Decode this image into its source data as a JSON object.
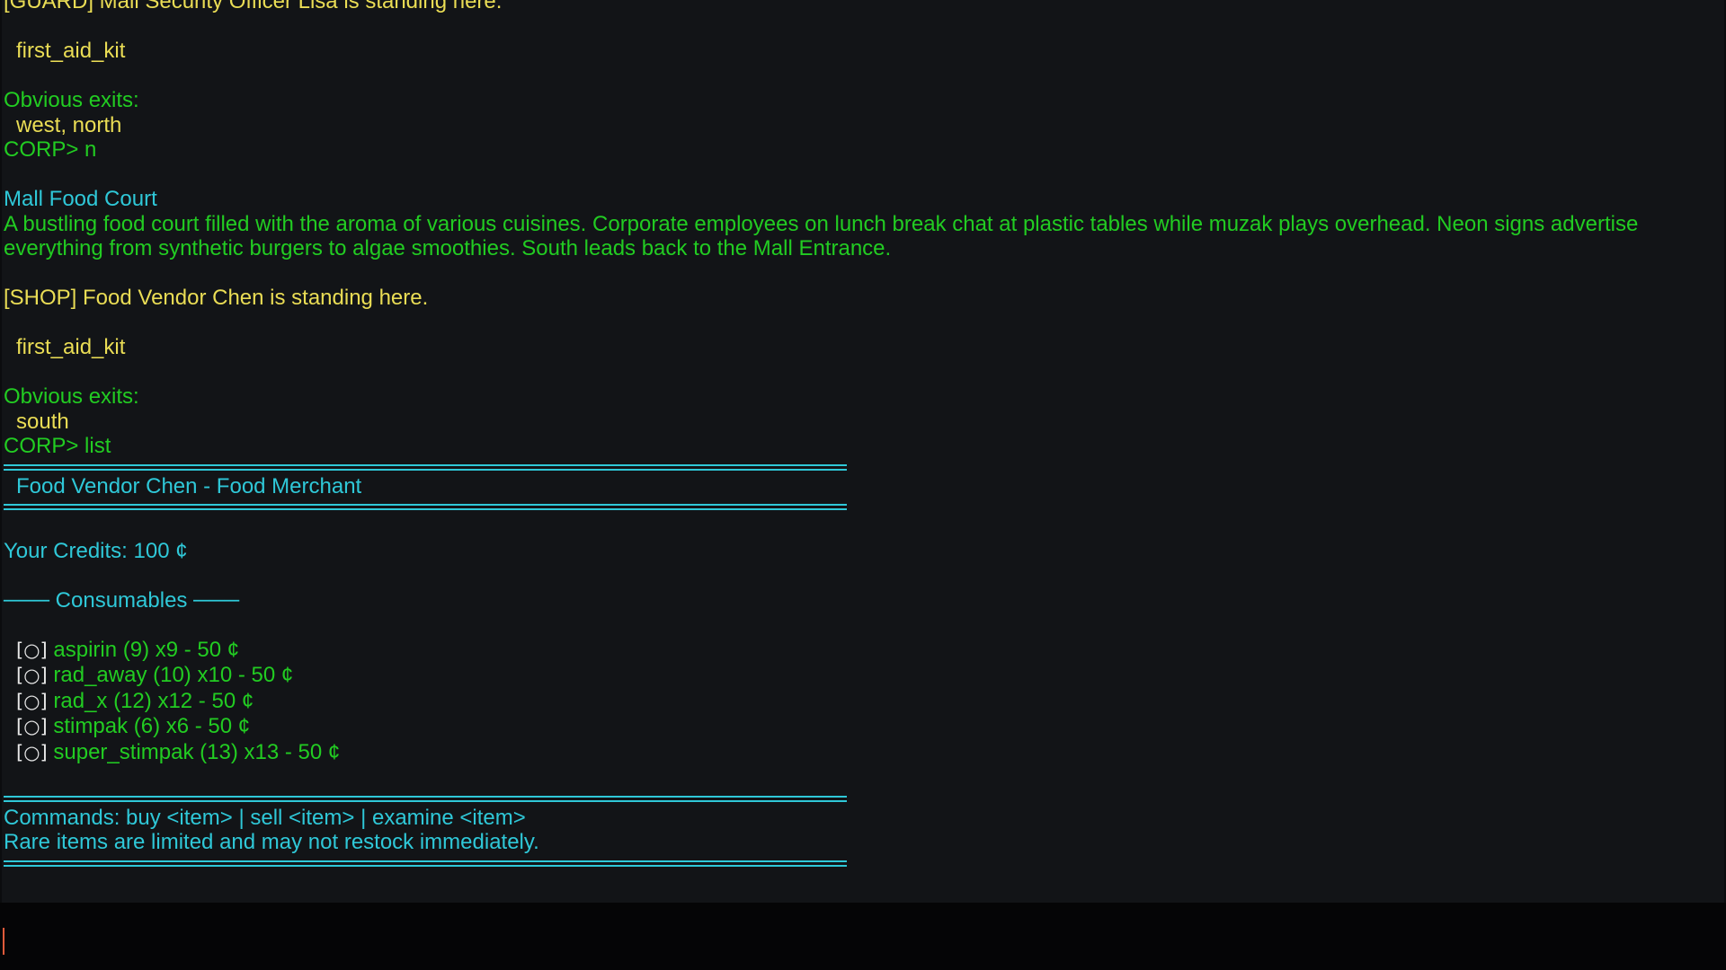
{
  "log": {
    "prev_guard_line": "[GUARD] Mall Security Officer Lisa is standing here.",
    "prev_item": "first_aid_kit",
    "prev_exits_label": "Obvious exits:",
    "prev_exits": "west, north",
    "prev_command": "CORP> n",
    "room_name": "Mall Food Court",
    "room_desc": "A bustling food court filled with the aroma of various cuisines. Corporate employees on lunch break chat at plastic tables while muzak plays overhead. Neon signs advertise everything from synthetic burgers to algae smoothies. South leads back to the Mall Entrance.",
    "npc_line": "[SHOP] Food Vendor Chen is standing here.",
    "room_item": "first_aid_kit",
    "exits_label": "Obvious exits:",
    "exits": "south",
    "command": "CORP> list"
  },
  "shop": {
    "title": "Food Vendor Chen - Food Merchant",
    "credits": "Your Credits: 100 ¢",
    "category": "─── Consumables ───",
    "item_marker": "[○]",
    "items": [
      {
        "text": "aspirin (9) x9 - 50 ¢"
      },
      {
        "text": "rad_away (10) x10 - 50 ¢"
      },
      {
        "text": "rad_x (12) x12 - 50 ¢"
      },
      {
        "text": "stimpak (6) x6 - 50 ¢"
      },
      {
        "text": "super_stimpak (13) x13 - 50 ¢"
      }
    ],
    "commands": "Commands: buy <item> | sell <item> | examine <item>",
    "note": "Rare items are limited and may not restock immediately."
  },
  "input": {
    "value": ""
  },
  "colors": {
    "system_yellow": "#eadd55",
    "room_green": "#22cc22",
    "shop_cyan": "#2fc8d8",
    "background": "#121417",
    "cursor": "#e05a3a"
  }
}
